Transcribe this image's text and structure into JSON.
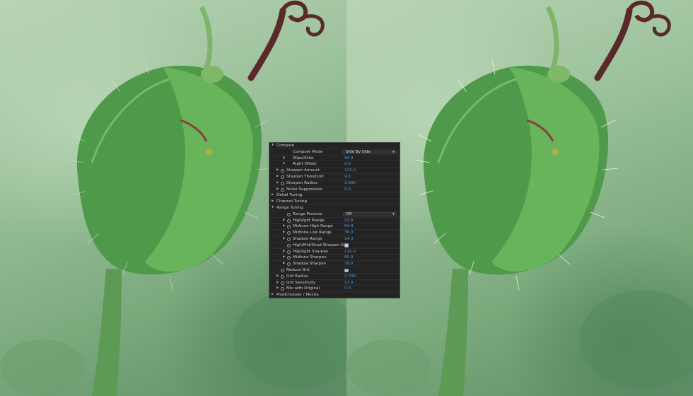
{
  "panel": {
    "rows": [
      {
        "kind": "section",
        "level": 0,
        "expanded": true,
        "label": "Compare"
      },
      {
        "kind": "dropdown",
        "level": 1,
        "stopwatch": false,
        "label": "Compare Mode",
        "value": "Side By Side"
      },
      {
        "kind": "value",
        "level": 1,
        "twirl": true,
        "stopwatch": false,
        "label": "Wipe/Slide",
        "value": "94.0"
      },
      {
        "kind": "value",
        "level": 1,
        "twirl": true,
        "stopwatch": false,
        "label": "Right Offset",
        "value": "0.0"
      },
      {
        "kind": "value",
        "level": 0,
        "twirl": true,
        "stopwatch": true,
        "label": "Sharpen Amount",
        "value": "120.0"
      },
      {
        "kind": "value",
        "level": 0,
        "twirl": true,
        "stopwatch": true,
        "label": "Sharpen Threshold",
        "value": "9.0"
      },
      {
        "kind": "value",
        "level": 0,
        "twirl": true,
        "stopwatch": true,
        "label": "Sharpen Radius",
        "value": "1.600"
      },
      {
        "kind": "value",
        "level": 0,
        "twirl": true,
        "stopwatch": true,
        "label": "Noise Suppression",
        "value": "9.0"
      },
      {
        "kind": "section",
        "level": 0,
        "expanded": false,
        "label": "Detail Tuning"
      },
      {
        "kind": "section",
        "level": 0,
        "expanded": false,
        "label": "Channel Tuning"
      },
      {
        "kind": "section",
        "level": 0,
        "expanded": true,
        "label": "Range Tuning"
      },
      {
        "kind": "dropdown",
        "level": 1,
        "stopwatch": true,
        "label": "Range Preview",
        "value": "Off"
      },
      {
        "kind": "value",
        "level": 1,
        "twirl": true,
        "stopwatch": true,
        "label": "Highlight Range",
        "value": "91.8"
      },
      {
        "kind": "value",
        "level": 1,
        "twirl": true,
        "stopwatch": true,
        "label": "Midtone High Range",
        "value": "64.0"
      },
      {
        "kind": "value",
        "level": 1,
        "twirl": true,
        "stopwatch": true,
        "label": "Midtone Low Range",
        "value": "36.0"
      },
      {
        "kind": "value",
        "level": 1,
        "twirl": true,
        "stopwatch": true,
        "label": "Shadow Range",
        "value": "14.3"
      },
      {
        "kind": "checkbox",
        "level": 1,
        "stopwatch": true,
        "label": "High/Mid/Shad Sharpen On",
        "checked": true
      },
      {
        "kind": "value",
        "level": 1,
        "twirl": true,
        "stopwatch": true,
        "label": "Highlight Sharpen",
        "value": "110.0"
      },
      {
        "kind": "value",
        "level": 1,
        "twirl": true,
        "stopwatch": true,
        "label": "Midtone Sharpen",
        "value": "85.0"
      },
      {
        "kind": "value",
        "level": 1,
        "twirl": true,
        "stopwatch": true,
        "label": "Shadow Sharpen",
        "value": "70.0"
      },
      {
        "kind": "checkbox",
        "level": 0,
        "stopwatch": true,
        "label": "Reduce Grit",
        "checked": true
      },
      {
        "kind": "value",
        "level": 0,
        "twirl": true,
        "stopwatch": true,
        "label": "Grit Radius",
        "value": "0.700"
      },
      {
        "kind": "value",
        "level": 0,
        "twirl": true,
        "stopwatch": true,
        "label": "Grit Sensitivity",
        "value": "11.0"
      },
      {
        "kind": "value",
        "level": 0,
        "twirl": true,
        "stopwatch": true,
        "label": "Mix with Original",
        "value": "0.0"
      },
      {
        "kind": "section",
        "level": 0,
        "expanded": false,
        "label": "PixelChooser / Mocha"
      }
    ]
  }
}
